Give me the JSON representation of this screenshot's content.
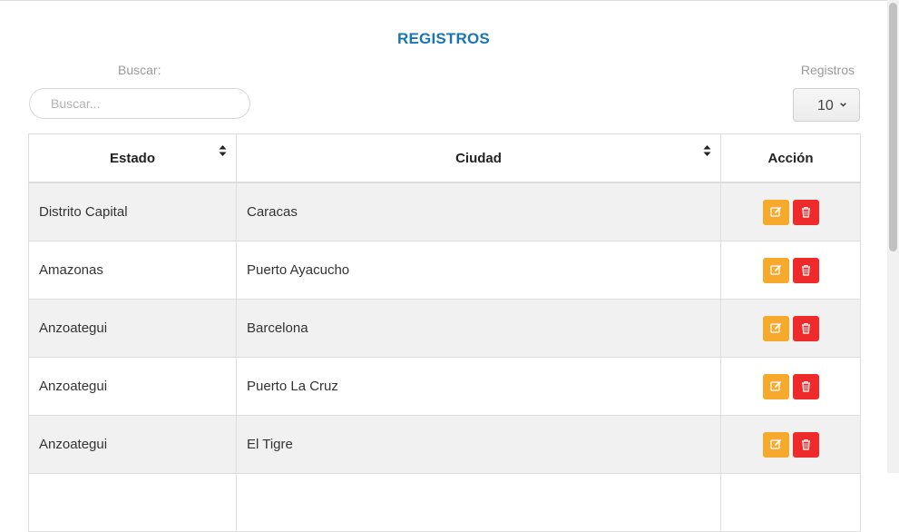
{
  "header": {
    "title": "REGISTROS"
  },
  "search": {
    "label": "Buscar:",
    "placeholder": "Buscar..."
  },
  "page_size": {
    "label": "Registros",
    "value": "10"
  },
  "table": {
    "columns": [
      "Estado",
      "Ciudad",
      "Acción"
    ],
    "rows": [
      {
        "estado": "Distrito Capital",
        "ciudad": "Caracas"
      },
      {
        "estado": "Amazonas",
        "ciudad": "Puerto Ayacucho"
      },
      {
        "estado": "Anzoategui",
        "ciudad": "Barcelona"
      },
      {
        "estado": "Anzoategui",
        "ciudad": "Puerto La Cruz"
      },
      {
        "estado": "Anzoategui",
        "ciudad": "El Tigre"
      }
    ]
  },
  "colors": {
    "title": "#1b74b3",
    "edit_button": "#f7a92c",
    "delete_button": "#ef2a2a",
    "row_striped": "#f1f1f1"
  },
  "icons": {
    "sort": "sort-icon",
    "edit": "edit-icon",
    "delete": "trash-icon",
    "select": "chevron-down-icon"
  }
}
